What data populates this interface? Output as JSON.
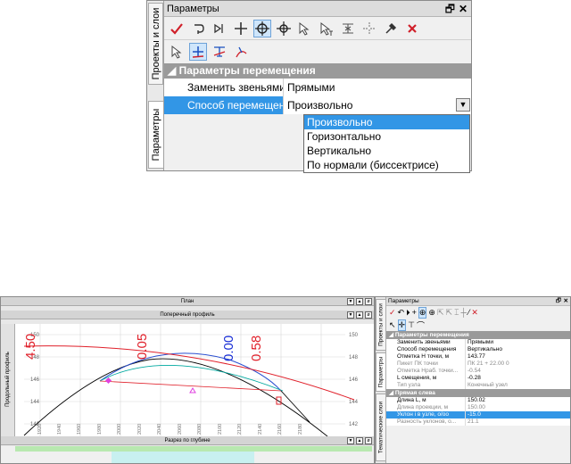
{
  "top_panel": {
    "title": "Параметры",
    "pin_icon_char": "🗗",
    "close_char": "✕",
    "tabs": [
      "Проекты и слои",
      "Параметры"
    ],
    "section": "Параметры перемещения",
    "rows": [
      {
        "label": "Заменить звеньями",
        "value": "Прямыми"
      },
      {
        "label": "Способ перемещения",
        "value": "Произвольно"
      }
    ],
    "dropdown_options": [
      "Произвольно",
      "Горизонтально",
      "Вертикально",
      "По нормали (биссектрисе)"
    ],
    "selected_option": "Произвольно"
  },
  "cad": {
    "plan_title": "План",
    "profile_title": "Поперечный профиль",
    "depth_title": "Разрез по глубине",
    "left_vertical_label": "Продольный профиль",
    "big_labels": [
      "4.50",
      "0.05",
      "0.00",
      "0.58"
    ],
    "y_ticks": [
      "150",
      "148",
      "146",
      "144",
      "142"
    ],
    "x_ticks": [
      "1920",
      "1940",
      "1960",
      "1980",
      "2000",
      "2020",
      "2040",
      "2060",
      "2080",
      "2100",
      "2120",
      "2140",
      "2160",
      "2180"
    ]
  },
  "right_panel": {
    "title": "Параметры",
    "tabs": [
      "Проекты и слои",
      "Параметры",
      "Тематические слои"
    ],
    "section1": "Параметры перемещения",
    "rows1": [
      {
        "label": "Заменить звеньями",
        "value": "Прямыми",
        "grey": false
      },
      {
        "label": "Способ перемещения",
        "value": "Вертикально",
        "grey": false
      },
      {
        "label": "Отметка Н точки, м",
        "value": "143.77",
        "grey": false
      },
      {
        "label": "Пикет ПК точки",
        "value": "ПК    21 + 22.00  0",
        "grey": true
      },
      {
        "label": "Отметка Нраб. точки...",
        "value": "-0.54",
        "grey": true
      },
      {
        "label": "L смещения, м",
        "value": "-0.28",
        "grey": false
      },
      {
        "label": "Тип узла",
        "value": "Конечный узел",
        "grey": true
      }
    ],
    "section2": "Прямая слева",
    "rows2": [
      {
        "label": "Длина L, м",
        "value": "150.02",
        "grey": false,
        "hl": false
      },
      {
        "label": "Длина проекции, м",
        "value": "150.00",
        "grey": true,
        "hl": false
      },
      {
        "label": "Уклон i в узле, о/оо",
        "value": "-15.0",
        "grey": false,
        "hl": true
      },
      {
        "label": "Разность уклонов, о...",
        "value": "21.1",
        "grey": true,
        "hl": false
      }
    ]
  },
  "colors": {
    "selection": "#3296e6",
    "section_header": "#9a9a9a",
    "red_label": "#e0202a",
    "blue_label": "#1a2fd6"
  }
}
